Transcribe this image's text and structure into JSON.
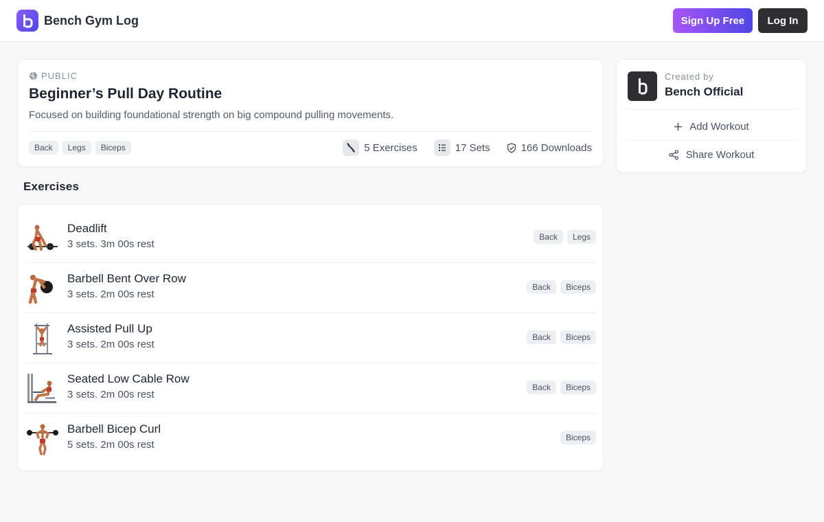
{
  "header": {
    "brand_name": "Bench Gym Log",
    "signup_label": "Sign Up Free",
    "login_label": "Log In"
  },
  "routine": {
    "visibility": "PUBLIC",
    "title": "Beginner’s Pull Day Routine",
    "description": "Focused on building foundational strength on big compound pulling movements.",
    "tags": [
      "Back",
      "Legs",
      "Biceps"
    ],
    "stats": {
      "exercises": "5 Exercises",
      "sets": "17 Sets",
      "downloads": "166 Downloads"
    }
  },
  "exercises_section": {
    "title": "Exercises",
    "items": [
      {
        "name": "Deadlift",
        "meta": "3 sets. 3m 00s rest",
        "tags": [
          "Back",
          "Legs"
        ]
      },
      {
        "name": "Barbell Bent Over Row",
        "meta": "3 sets. 2m 00s rest",
        "tags": [
          "Back",
          "Biceps"
        ]
      },
      {
        "name": "Assisted Pull Up",
        "meta": "3 sets. 2m 00s rest",
        "tags": [
          "Back",
          "Biceps"
        ]
      },
      {
        "name": "Seated Low Cable Row",
        "meta": "3 sets. 2m 00s rest",
        "tags": [
          "Back",
          "Biceps"
        ]
      },
      {
        "name": "Barbell Bicep Curl",
        "meta": "5 sets. 2m 00s rest",
        "tags": [
          "Biceps"
        ]
      }
    ]
  },
  "creator": {
    "created_by_label": "Created by",
    "name": "Bench Official",
    "add_workout_label": "Add Workout",
    "share_workout_label": "Share Workout"
  },
  "colors": {
    "brand_gradient_start": "#a855f7",
    "brand_gradient_end": "#4f46e5",
    "login_button": "#2f2f31",
    "tag_background": "#eeeff2"
  },
  "icons": {
    "brand": "bench-logo-icon",
    "visibility": "globe-icon",
    "exercises": "dumbbell-icon",
    "sets": "list-icon",
    "downloads": "shield-check-icon",
    "add": "plus-icon",
    "share": "share-icon"
  }
}
